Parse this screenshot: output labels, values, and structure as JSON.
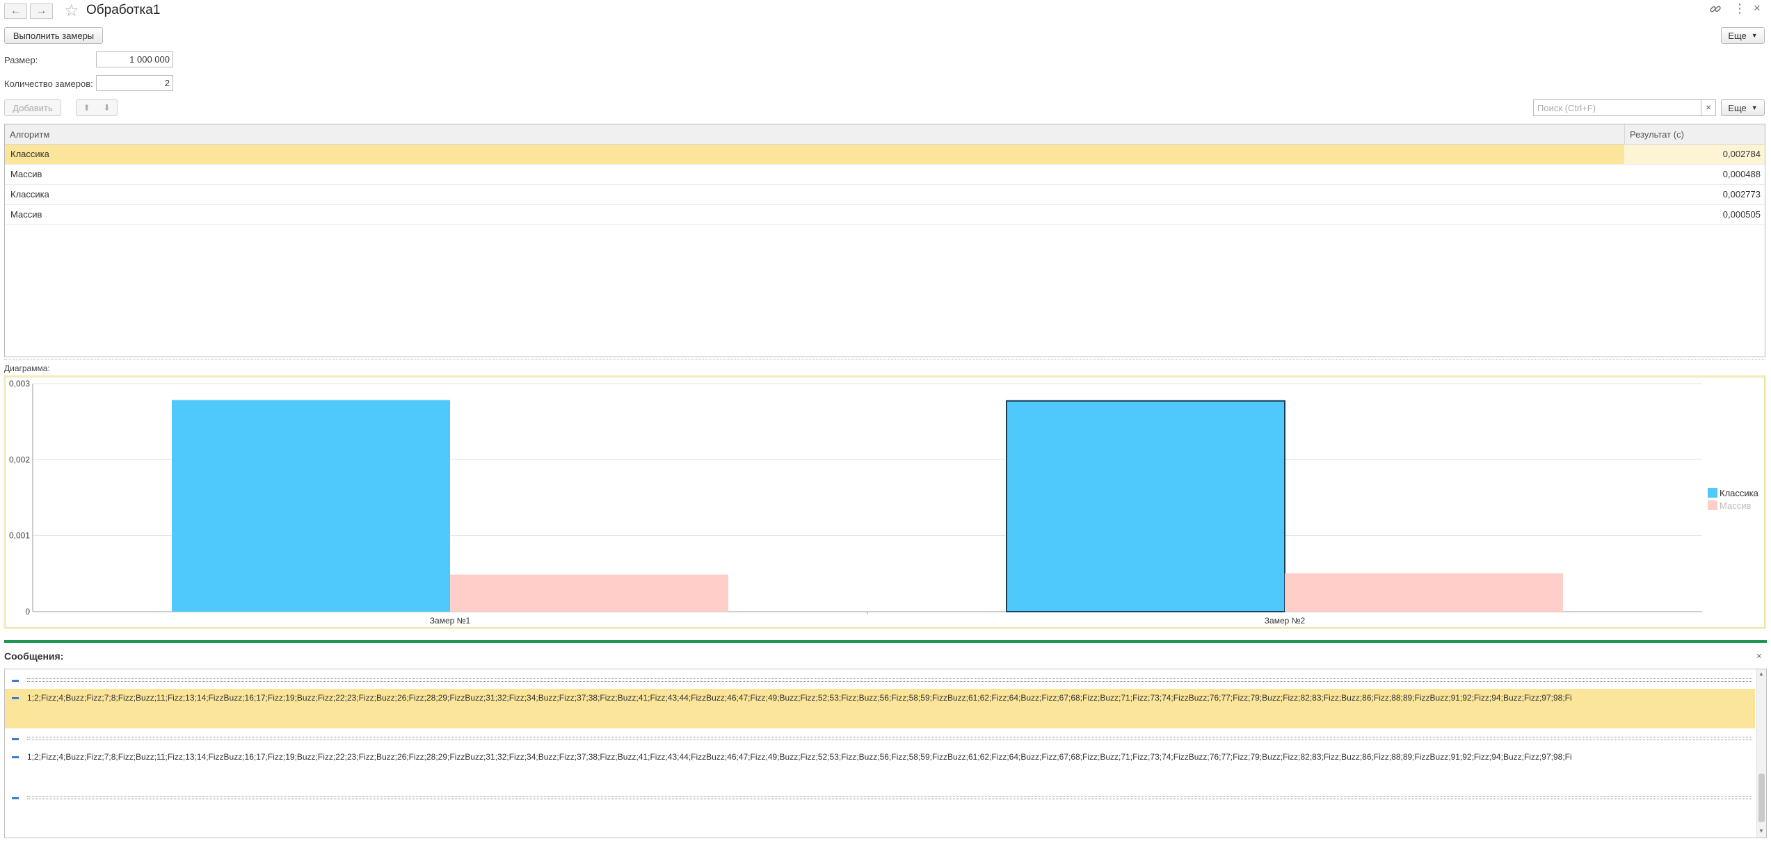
{
  "window": {
    "title": "Обработка1",
    "back_icon": "←",
    "forward_icon": "→"
  },
  "header_actions": {
    "link_icon": "🔗",
    "more_icon": "⋮",
    "close_icon": "×"
  },
  "toolbar": {
    "run_label": "Выполнить замеры",
    "more_label": "Еще"
  },
  "params": {
    "size_label": "Размер:",
    "size_value": "1 000 000",
    "count_label": "Количество замеров:",
    "count_value": "2"
  },
  "table_toolbar": {
    "add_label": "Добавить",
    "up_icon": "🡅",
    "down_icon": "🡇",
    "search_placeholder": "Поиск (Ctrl+F)",
    "search_clear": "×",
    "more_label": "Еще"
  },
  "table": {
    "columns": [
      "Алгоритм",
      "Результат (с)"
    ],
    "rows": [
      {
        "algorithm": "Классика",
        "result": "0,002784"
      },
      {
        "algorithm": "Массив",
        "result": "0,000488"
      },
      {
        "algorithm": "Классика",
        "result": "0,002773"
      },
      {
        "algorithm": "Массив",
        "result": "0,000505"
      }
    ]
  },
  "chart_label": "Диаграмма:",
  "chart_data": {
    "type": "bar",
    "categories": [
      "Замер №1",
      "Замер №2"
    ],
    "series": [
      {
        "name": "Классика",
        "values": [
          0.002784,
          0.002773
        ],
        "color": "#4fc8fc"
      },
      {
        "name": "Массив",
        "values": [
          0.000488,
          0.000505
        ],
        "color": "#ffcec8"
      }
    ],
    "yticks": [
      "0",
      "0,001",
      "0,002",
      "0,003"
    ],
    "ylim": [
      0,
      0.003
    ],
    "grid": true,
    "legend": "right"
  },
  "messages": {
    "title": "Сообщения:",
    "close_icon": "×",
    "items": [
      {
        "type": "separator"
      },
      {
        "type": "text",
        "text": "1;2;Fizz;4;Buzz;Fizz;7;8;Fizz;Buzz;11;Fizz;13;14;FizzBuzz;16;17;Fizz;19;Buzz;Fizz;22;23;Fizz;Buzz;26;Fizz;28;29;FizzBuzz;31;32;Fizz;34;Buzz;Fizz;37;38;Fizz;Buzz;41;Fizz;43;44;FizzBuzz;46;47;Fizz;49;Buzz;Fizz;52;53;Fizz;Buzz;56;Fizz;58;59;FizzBuzz;61;62;Fizz;64;Buzz;Fizz;67;68;Fizz;Buzz;71;Fizz;73;74;FizzBuzz;76;77;Fizz;79;Buzz;Fizz;82;83;Fizz;Buzz;86;Fizz;88;89;FizzBuzz;91;92;Fizz;94;Buzz;Fizz;97;98;Fi"
      },
      {
        "type": "separator"
      },
      {
        "type": "text",
        "text": "1;2;Fizz;4;Buzz;Fizz;7;8;Fizz;Buzz;11;Fizz;13;14;FizzBuzz;16;17;Fizz;19;Buzz;Fizz;22;23;Fizz;Buzz;26;Fizz;28;29;FizzBuzz;31;32;Fizz;34;Buzz;Fizz;37;38;Fizz;Buzz;41;Fizz;43;44;FizzBuzz;46;47;Fizz;49;Buzz;Fizz;52;53;Fizz;Buzz;56;Fizz;58;59;FizzBuzz;61;62;Fizz;64;Buzz;Fizz;67;68;Fizz;Buzz;71;Fizz;73;74;FizzBuzz;76;77;Fizz;79;Buzz;Fizz;82;83;Fizz;Buzz;86;Fizz;88;89;FizzBuzz;91;92;Fizz;94;Buzz;Fizz;97;98;Fi"
      },
      {
        "type": "separator"
      }
    ]
  },
  "colors": {
    "selection": "#fbe59a",
    "accent_green": "#1e9654",
    "chart_frame": "#f7eec3"
  }
}
